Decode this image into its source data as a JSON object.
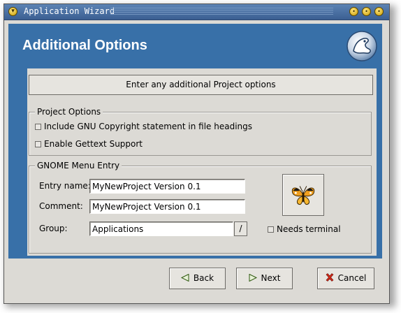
{
  "window": {
    "title": "Application Wizard",
    "title_menu_icon": "menu-icon",
    "controls": [
      "minimize-icon",
      "maximize-icon",
      "close-icon"
    ]
  },
  "header": {
    "title": "Additional Options",
    "logo_icon": "gnome-foot-logo"
  },
  "description": "Enter any additional Project options",
  "project_options": {
    "label": "Project Options",
    "checkboxes": [
      {
        "label": "Include GNU Copyright statement in file headings",
        "checked": false
      },
      {
        "label": "Enable Gettext Support",
        "checked": false
      }
    ]
  },
  "menu_entry": {
    "label": "GNOME Menu Entry",
    "entry_name_label": "Entry name:",
    "entry_name_value": "MyNewProject Version 0.1",
    "comment_label": "Comment:",
    "comment_value": "MyNewProject Version 0.1",
    "group_label": "Group:",
    "group_value": "Applications",
    "icon": "butterfly-icon",
    "needs_terminal_label": "Needs terminal",
    "needs_terminal_checked": false
  },
  "buttons": {
    "back": "Back",
    "next": "Next",
    "cancel": "Cancel"
  },
  "colors": {
    "header_bg": "#3870a8",
    "titlebar": "#4a71a3",
    "dialog_bg": "#dcdad5"
  }
}
